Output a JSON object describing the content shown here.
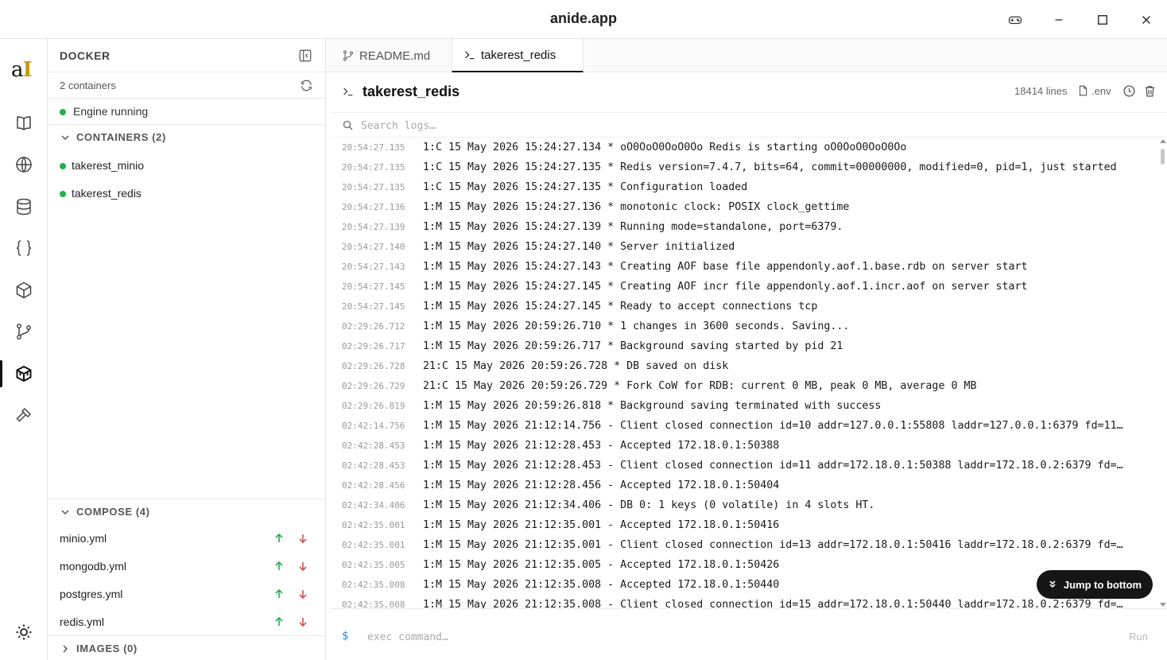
{
  "window": {
    "title": "anide.app"
  },
  "sidebar": {
    "header": "DOCKER",
    "containers_count": "2 containers",
    "engine_status": "Engine running",
    "containers_section": "CONTAINERS (2)",
    "containers": [
      {
        "name": "takerest_minio",
        "status_color": "#22b14c"
      },
      {
        "name": "takerest_redis",
        "status_color": "#22b14c"
      }
    ],
    "compose_section": "COMPOSE (4)",
    "compose": [
      {
        "name": "minio.yml"
      },
      {
        "name": "mongodb.yml"
      },
      {
        "name": "postgres.yml"
      },
      {
        "name": "redis.yml"
      }
    ],
    "images_section": "IMAGES (0)"
  },
  "tabs": [
    {
      "label": "README.md",
      "icon": "git-branch-icon"
    },
    {
      "label": "takerest_redis",
      "icon": "terminal-icon",
      "active": true
    }
  ],
  "log_panel": {
    "title": "takerest_redis",
    "line_count": "18414 lines",
    "env_label": ".env",
    "search_placeholder": "Search logs…",
    "jump_label": "Jump to bottom",
    "exec_prompt": "$",
    "exec_placeholder": "exec command…",
    "run_label": "Run"
  },
  "logs": [
    {
      "ts": "20:54:27.135",
      "msg": "1:C 15 May 2026 15:24:27.134 * oO0OoO0OoO0Oo Redis is starting oO0OoO0OoO0Oo"
    },
    {
      "ts": "20:54:27.135",
      "msg": "1:C 15 May 2026 15:24:27.135 * Redis version=7.4.7, bits=64, commit=00000000, modified=0, pid=1, just started"
    },
    {
      "ts": "20:54:27.135",
      "msg": "1:C 15 May 2026 15:24:27.135 * Configuration loaded"
    },
    {
      "ts": "20:54:27.136",
      "msg": "1:M 15 May 2026 15:24:27.136 * monotonic clock: POSIX clock_gettime"
    },
    {
      "ts": "20:54:27.139",
      "msg": "1:M 15 May 2026 15:24:27.139 * Running mode=standalone, port=6379."
    },
    {
      "ts": "20:54:27.140",
      "msg": "1:M 15 May 2026 15:24:27.140 * Server initialized"
    },
    {
      "ts": "20:54:27.143",
      "msg": "1:M 15 May 2026 15:24:27.143 * Creating AOF base file appendonly.aof.1.base.rdb on server start"
    },
    {
      "ts": "20:54:27.145",
      "msg": "1:M 15 May 2026 15:24:27.145 * Creating AOF incr file appendonly.aof.1.incr.aof on server start"
    },
    {
      "ts": "20:54:27.145",
      "msg": "1:M 15 May 2026 15:24:27.145 * Ready to accept connections tcp"
    },
    {
      "ts": "02:29:26.712",
      "msg": "1:M 15 May 2026 20:59:26.710 * 1 changes in 3600 seconds. Saving..."
    },
    {
      "ts": "02:29:26.717",
      "msg": "1:M 15 May 2026 20:59:26.717 * Background saving started by pid 21"
    },
    {
      "ts": "02:29:26.728",
      "msg": "21:C 15 May 2026 20:59:26.728 * DB saved on disk"
    },
    {
      "ts": "02:29:26.729",
      "msg": "21:C 15 May 2026 20:59:26.729 * Fork CoW for RDB: current 0 MB, peak 0 MB, average 0 MB"
    },
    {
      "ts": "02:29:26.819",
      "msg": "1:M 15 May 2026 20:59:26.818 * Background saving terminated with success"
    },
    {
      "ts": "02:42:14.756",
      "msg": "1:M 15 May 2026 21:12:14.756 - Client closed connection id=10 addr=127.0.0.1:55808 laddr=127.0.0.1:6379 fd=11…"
    },
    {
      "ts": "02:42:28.453",
      "msg": "1:M 15 May 2026 21:12:28.453 - Accepted 172.18.0.1:50388"
    },
    {
      "ts": "02:42:28.453",
      "msg": "1:M 15 May 2026 21:12:28.453 - Client closed connection id=11 addr=172.18.0.1:50388 laddr=172.18.0.2:6379 fd=…"
    },
    {
      "ts": "02:42:28.456",
      "msg": "1:M 15 May 2026 21:12:28.456 - Accepted 172.18.0.1:50404"
    },
    {
      "ts": "02:42:34.406",
      "msg": "1:M 15 May 2026 21:12:34.406 - DB 0: 1 keys (0 volatile) in 4 slots HT."
    },
    {
      "ts": "02:42:35.001",
      "msg": "1:M 15 May 2026 21:12:35.001 - Accepted 172.18.0.1:50416"
    },
    {
      "ts": "02:42:35.001",
      "msg": "1:M 15 May 2026 21:12:35.001 - Client closed connection id=13 addr=172.18.0.1:50416 laddr=172.18.0.2:6379 fd=…"
    },
    {
      "ts": "02:42:35.005",
      "msg": "1:M 15 May 2026 21:12:35.005 - Accepted 172.18.0.1:50426"
    },
    {
      "ts": "02:42:35.008",
      "msg": "1:M 15 May 2026 21:12:35.008 - Accepted 172.18.0.1:50440"
    },
    {
      "ts": "02:42:35.008",
      "msg": "1:M 15 May 2026 21:12:35.008 - Client closed connection id=15 addr=172.18.0.1:50440 laddr=172.18.0.2:6379 fd=…"
    }
  ],
  "colors": {
    "accent": "#111111",
    "running": "#22b14c",
    "up_arrow": "#22b14c",
    "down_arrow": "#e0484f",
    "prompt": "#2a8ee8"
  }
}
